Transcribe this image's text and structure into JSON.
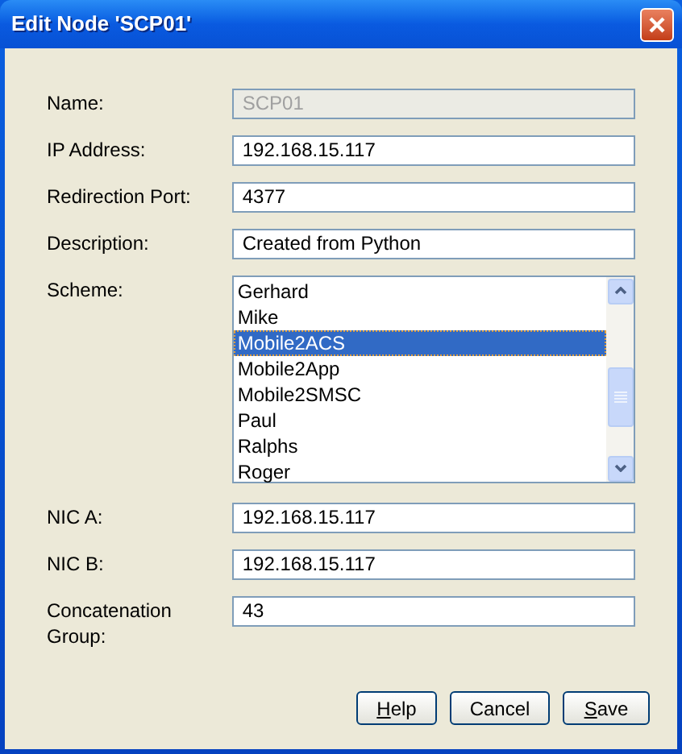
{
  "window": {
    "title": "Edit Node 'SCP01'"
  },
  "fields": [
    {
      "kind": "text",
      "label": "Name:",
      "value": "SCP01",
      "disabled": true
    },
    {
      "kind": "text",
      "label": "IP Address:",
      "value": "192.168.15.117",
      "disabled": false
    },
    {
      "kind": "text",
      "label": "Redirection Port:",
      "value": "4377",
      "disabled": false
    },
    {
      "kind": "text",
      "label": "Description:",
      "value": "Created from Python",
      "disabled": false
    },
    {
      "kind": "list",
      "label": "Scheme:",
      "items": [
        {
          "label": "Gerhard",
          "selected": false
        },
        {
          "label": "Mike",
          "selected": false
        },
        {
          "label": "Mobile2ACS",
          "selected": true
        },
        {
          "label": "Mobile2App",
          "selected": false
        },
        {
          "label": "Mobile2SMSC",
          "selected": false
        },
        {
          "label": "Paul",
          "selected": false
        },
        {
          "label": "Ralphs",
          "selected": false
        },
        {
          "label": "Roger",
          "selected": false
        }
      ]
    },
    {
      "kind": "text",
      "label": "NIC A:",
      "value": "192.168.15.117",
      "disabled": false
    },
    {
      "kind": "text",
      "label": "NIC B:",
      "value": "192.168.15.117",
      "disabled": false
    },
    {
      "kind": "text",
      "label": "Concatenation Group:",
      "value": "43",
      "disabled": false
    }
  ],
  "buttons": [
    {
      "label": "Help",
      "mnemonic": true
    },
    {
      "label": "Cancel",
      "mnemonic": false
    },
    {
      "label": "Save",
      "mnemonic": true
    }
  ]
}
